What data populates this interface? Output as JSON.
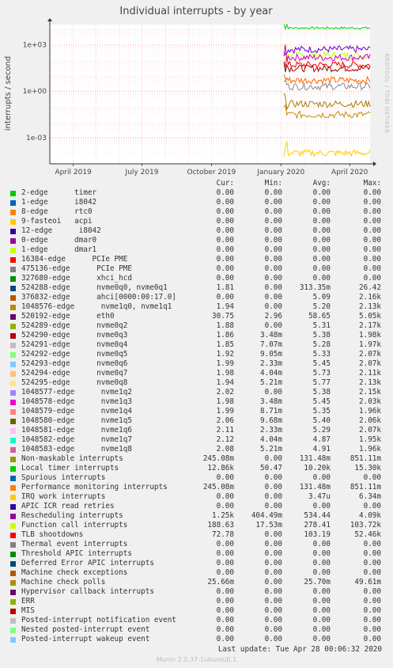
{
  "chart_data": {
    "type": "line",
    "title": "Individual interrupts - by year",
    "ylabel": "interrupts / second",
    "side_label": "RRDTOOL / TOBI OETIKER",
    "y_scale": "log",
    "ylim": [
      2e-05,
      20000
    ],
    "y_ticks": [
      "1e+03",
      "1e+00",
      "1e-03"
    ],
    "x_ticks": [
      "April 2019",
      "July 2019",
      "October 2019",
      "January 2020",
      "April 2020"
    ],
    "x_range": [
      "2019-03-01",
      "2020-04-28"
    ],
    "data_start": "2020-01-05",
    "grid": true,
    "series_shown": [
      {
        "name": "Local timer interrupts",
        "color": "#00cc00",
        "level": 12000
      },
      {
        "name": "Function call interrupts",
        "color": "#ccff00",
        "level": 200
      },
      {
        "name": "Rescheduling interrupts",
        "color": "#6600cc",
        "level": 500
      },
      {
        "name": "nvme0q1",
        "color": "#cc00cc",
        "level": 150
      },
      {
        "name": "TLB shootdowns",
        "color": "#ff0000",
        "level": 50
      },
      {
        "name": "eth0",
        "color": "#990000",
        "level": 30
      },
      {
        "name": "nvme0q2",
        "color": "#ff6600",
        "level": 5
      },
      {
        "name": "nvme",
        "color": "#888888",
        "level": 2
      },
      {
        "name": "Machine check polls",
        "color": "#cc8800",
        "level": 0.03
      },
      {
        "name": "ahci",
        "color": "#aa7700",
        "level": 0.15
      },
      {
        "name": "Performance monitoring interrupts",
        "color": "#ffcc00",
        "level": 0.0001
      }
    ]
  },
  "legend": {
    "headers": {
      "cur": "Cur:",
      "min": "Min:",
      "avg": "Avg:",
      "max": "Max:"
    },
    "rows": [
      {
        "name": "2-edge      timer",
        "color": "#00cc00",
        "cur": "0.00",
        "min": "0.00",
        "avg": "0.00",
        "max": "0.00"
      },
      {
        "name": "1-edge      i8042",
        "color": "#0066b3",
        "cur": "0.00",
        "min": "0.00",
        "avg": "0.00",
        "max": "0.00"
      },
      {
        "name": "8-edge      rtc0",
        "color": "#ff8000",
        "cur": "0.00",
        "min": "0.00",
        "avg": "0.00",
        "max": "0.00"
      },
      {
        "name": "9-fasteoi   acpi",
        "color": "#ffcc00",
        "cur": "0.00",
        "min": "0.00",
        "avg": "0.00",
        "max": "0.00"
      },
      {
        "name": "12-edge      i8042",
        "color": "#330099",
        "cur": "0.00",
        "min": "0.00",
        "avg": "0.00",
        "max": "0.00"
      },
      {
        "name": "0-edge      dmar0",
        "color": "#990099",
        "cur": "0.00",
        "min": "0.00",
        "avg": "0.00",
        "max": "0.00"
      },
      {
        "name": "1-edge      dmar1",
        "color": "#ccff00",
        "cur": "0.00",
        "min": "0.00",
        "avg": "0.00",
        "max": "0.00"
      },
      {
        "name": "16384-edge      PCIe PME",
        "color": "#ff0000",
        "cur": "0.00",
        "min": "0.00",
        "avg": "0.00",
        "max": "0.00"
      },
      {
        "name": "475136-edge      PCIe PME",
        "color": "#808080",
        "cur": "0.00",
        "min": "0.00",
        "avg": "0.00",
        "max": "0.00"
      },
      {
        "name": "327680-edge      xhci_hcd",
        "color": "#008f00",
        "cur": "0.00",
        "min": "0.00",
        "avg": "0.00",
        "max": "0.00"
      },
      {
        "name": "524288-edge      nvme0q0, nvme0q1",
        "color": "#00487d",
        "cur": "1.81",
        "min": "0.00",
        "avg": "313.35m",
        "max": "26.42"
      },
      {
        "name": "376832-edge      ahci[0000:00:17.0]",
        "color": "#b35a00",
        "cur": "0.00",
        "min": "0.00",
        "avg": "5.09",
        "max": "2.16k"
      },
      {
        "name": "1048576-edge      nvme1q0, nvme1q1",
        "color": "#b38f00",
        "cur": "1.94",
        "min": "0.00",
        "avg": "5.20",
        "max": "2.13k"
      },
      {
        "name": "520192-edge      eth0",
        "color": "#6b006b",
        "cur": "30.75",
        "min": "2.96",
        "avg": "58.65",
        "max": "5.05k"
      },
      {
        "name": "524289-edge      nvme0q2",
        "color": "#8fb300",
        "cur": "1.88",
        "min": "0.00",
        "avg": "5.31",
        "max": "2.17k"
      },
      {
        "name": "524290-edge      nvme0q3",
        "color": "#b30000",
        "cur": "1.86",
        "min": "3.48m",
        "avg": "5.38",
        "max": "1.98k"
      },
      {
        "name": "524291-edge      nvme0q4",
        "color": "#bebebe",
        "cur": "1.85",
        "min": "7.07m",
        "avg": "5.28",
        "max": "1.97k"
      },
      {
        "name": "524292-edge      nvme0q5",
        "color": "#80ff80",
        "cur": "1.92",
        "min": "9.05m",
        "avg": "5.33",
        "max": "2.07k"
      },
      {
        "name": "524293-edge      nvme0q6",
        "color": "#80c9ff",
        "cur": "1.99",
        "min": "2.33m",
        "avg": "5.45",
        "max": "2.07k"
      },
      {
        "name": "524294-edge      nvme0q7",
        "color": "#ffc080",
        "cur": "1.98",
        "min": "4.04m",
        "avg": "5.73",
        "max": "2.11k"
      },
      {
        "name": "524295-edge      nvme0q8",
        "color": "#ffe680",
        "cur": "1.94",
        "min": "5.21m",
        "avg": "5.77",
        "max": "2.13k"
      },
      {
        "name": "1048577-edge      nvme1q2",
        "color": "#aa80ff",
        "cur": "2.02",
        "min": "0.00",
        "avg": "5.38",
        "max": "2.15k"
      },
      {
        "name": "1048578-edge      nvme1q3",
        "color": "#ee00cc",
        "cur": "1.98",
        "min": "3.48m",
        "avg": "5.45",
        "max": "2.03k"
      },
      {
        "name": "1048579-edge      nvme1q4",
        "color": "#ff8080",
        "cur": "1.99",
        "min": "8.71m",
        "avg": "5.35",
        "max": "1.96k"
      },
      {
        "name": "1048580-edge      nvme1q5",
        "color": "#666600",
        "cur": "2.06",
        "min": "9.68m",
        "avg": "5.40",
        "max": "2.06k"
      },
      {
        "name": "1048581-edge      nvme1q6",
        "color": "#ffbfff",
        "cur": "2.11",
        "min": "2.33m",
        "avg": "5.29",
        "max": "2.07k"
      },
      {
        "name": "1048582-edge      nvme1q7",
        "color": "#00ffcc",
        "cur": "2.12",
        "min": "4.04m",
        "avg": "4.87",
        "max": "1.95k"
      },
      {
        "name": "1048583-edge      nvme1q8",
        "color": "#cc6699",
        "cur": "2.08",
        "min": "5.21m",
        "avg": "4.91",
        "max": "1.96k"
      },
      {
        "name": "Non-maskable interrupts",
        "color": "#999900",
        "cur": "245.08m",
        "min": "0.00",
        "avg": "131.48m",
        "max": "851.11m"
      },
      {
        "name": "Local timer interrupts",
        "color": "#00cc00",
        "cur": "12.86k",
        "min": "50.47",
        "avg": "10.20k",
        "max": "15.30k"
      },
      {
        "name": "Spurious interrupts",
        "color": "#0066b3",
        "cur": "0.00",
        "min": "0.00",
        "avg": "0.00",
        "max": "0.00"
      },
      {
        "name": "Performance monitoring interrupts",
        "color": "#ff8000",
        "cur": "245.08m",
        "min": "0.00",
        "avg": "131.48m",
        "max": "851.11m"
      },
      {
        "name": "IRQ work interrupts",
        "color": "#ffcc00",
        "cur": "0.00",
        "min": "0.00",
        "avg": "3.47u",
        "max": "6.34m"
      },
      {
        "name": "APIC ICR read retries",
        "color": "#330099",
        "cur": "0.00",
        "min": "0.00",
        "avg": "0.00",
        "max": "0.00"
      },
      {
        "name": "Rescheduling interrupts",
        "color": "#990099",
        "cur": "1.25k",
        "min": "404.49m",
        "avg": "534.44",
        "max": "4.09k"
      },
      {
        "name": "Function call interrupts",
        "color": "#ccff00",
        "cur": "188.63",
        "min": "17.53m",
        "avg": "278.41",
        "max": "103.72k"
      },
      {
        "name": "TLB shootdowns",
        "color": "#ff0000",
        "cur": "72.78",
        "min": "0.00",
        "avg": "103.19",
        "max": "52.46k"
      },
      {
        "name": "Thermal event interrupts",
        "color": "#808080",
        "cur": "0.00",
        "min": "0.00",
        "avg": "0.00",
        "max": "0.00"
      },
      {
        "name": "Threshold APIC interrupts",
        "color": "#008f00",
        "cur": "0.00",
        "min": "0.00",
        "avg": "0.00",
        "max": "0.00"
      },
      {
        "name": "Deferred Error APIC interrupts",
        "color": "#00487d",
        "cur": "0.00",
        "min": "0.00",
        "avg": "0.00",
        "max": "0.00"
      },
      {
        "name": "Machine check exceptions",
        "color": "#b35a00",
        "cur": "0.00",
        "min": "0.00",
        "avg": "0.00",
        "max": "0.00"
      },
      {
        "name": "Machine check polls",
        "color": "#b38f00",
        "cur": "25.66m",
        "min": "0.00",
        "avg": "25.70m",
        "max": "49.61m"
      },
      {
        "name": "Hypervisor callback interrupts",
        "color": "#6b006b",
        "cur": "0.00",
        "min": "0.00",
        "avg": "0.00",
        "max": "0.00"
      },
      {
        "name": "ERR",
        "color": "#8fb300",
        "cur": "0.00",
        "min": "0.00",
        "avg": "0.00",
        "max": "0.00"
      },
      {
        "name": "MIS",
        "color": "#b30000",
        "cur": "0.00",
        "min": "0.00",
        "avg": "0.00",
        "max": "0.00"
      },
      {
        "name": "Posted-interrupt notification event",
        "color": "#bebebe",
        "cur": "0.00",
        "min": "0.00",
        "avg": "0.00",
        "max": "0.00"
      },
      {
        "name": "Nested posted-interrupt event",
        "color": "#80ff80",
        "cur": "0.00",
        "min": "0.00",
        "avg": "0.00",
        "max": "0.00"
      },
      {
        "name": "Posted-interrupt wakeup event",
        "color": "#80c9ff",
        "cur": "0.00",
        "min": "0.00",
        "avg": "0.00",
        "max": "0.00"
      }
    ]
  },
  "last_update": "Last update: Tue Apr 28 00:06:32 2020",
  "footer": "Munin 2.0.37-1ubuntu0.1"
}
